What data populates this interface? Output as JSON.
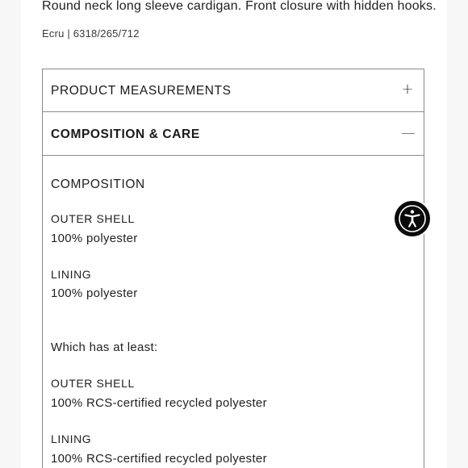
{
  "product": {
    "description": "Round neck long sleeve cardigan. Front closure with hidden hooks.",
    "color_ref": "Ecru | 6318/265/712"
  },
  "accordion": {
    "measurements": {
      "label": "PRODUCT MEASUREMENTS",
      "icon": "plus-icon",
      "glyph": "+"
    },
    "composition": {
      "label": "COMPOSITION & CARE",
      "icon": "minus-icon",
      "glyph": "—"
    }
  },
  "composition_panel": {
    "heading": "COMPOSITION",
    "outer_shell_label": "OUTER SHELL",
    "outer_shell_value": "100% polyester",
    "lining_label": "LINING",
    "lining_value": "100% polyester",
    "intro": "Which has at least:",
    "recycled_outer_label": "OUTER SHELL",
    "recycled_outer_value": "100% RCS-certified recycled polyester",
    "recycled_lining_label": "LINING",
    "recycled_lining_value": "100% RCS-certified recycled polyester"
  },
  "accessibility": {
    "icon": "accessibility-icon"
  }
}
